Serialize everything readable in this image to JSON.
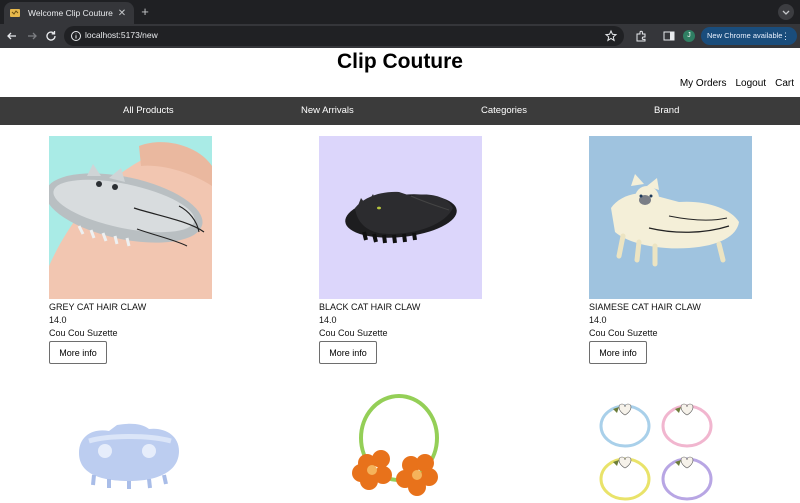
{
  "browser": {
    "tab_title": "Welcome Clip Couture",
    "tab_close": "✕",
    "new_tab": "+",
    "url": "localhost:5173/new",
    "profile_initial": "J",
    "update_label": "New Chrome available",
    "update_menu": "⋮"
  },
  "site": {
    "title": "Clip Couture",
    "user_links": [
      "My Orders",
      "Logout",
      "Cart"
    ]
  },
  "nav": {
    "items": [
      "All Products",
      "New Arrivals",
      "Categories",
      "Brand"
    ]
  },
  "products": [
    {
      "name": "GREY CAT HAIR CLAW",
      "price": "14.0",
      "brand": "Cou Cou Suzette",
      "button": "More info",
      "bg": "#a9ebe6"
    },
    {
      "name": "BLACK CAT HAIR CLAW",
      "price": "14.0",
      "brand": "Cou Cou Suzette",
      "button": "More info",
      "bg": "#dcd6fb"
    },
    {
      "name": "SIAMESE CAT HAIR CLAW",
      "price": "14.0",
      "brand": "Cou Cou Suzette",
      "button": "More info",
      "bg": "#9fc3df"
    }
  ],
  "colors": {
    "tabbar": "#1f2023",
    "toolbar": "#35363a",
    "navbar": "#3b3b3b"
  }
}
